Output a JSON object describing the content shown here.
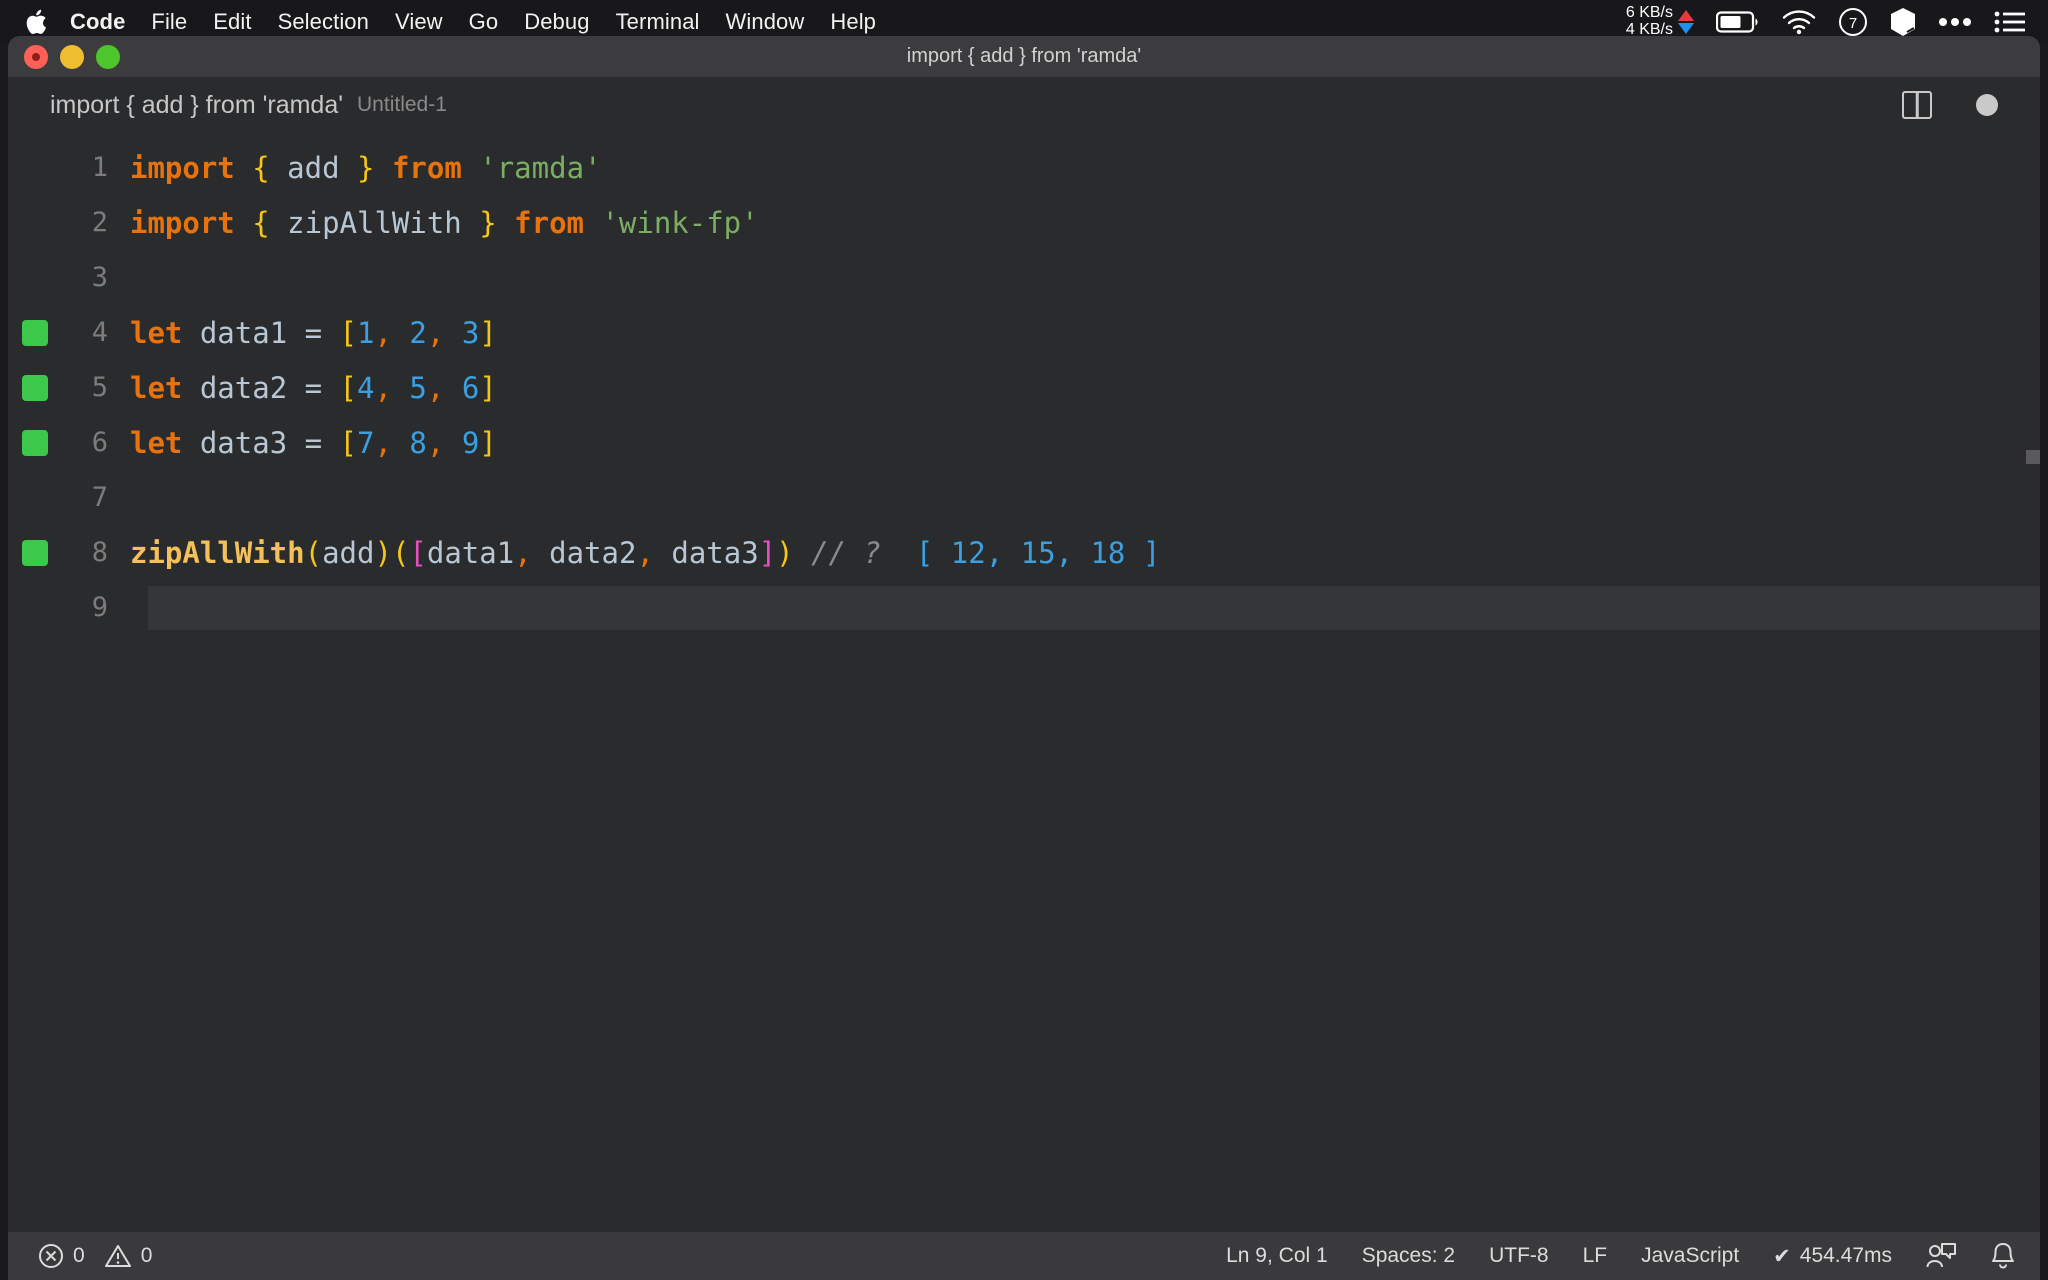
{
  "menubar": {
    "apple_icon": "apple-logo-icon",
    "items": [
      {
        "label": "Code",
        "bold": true
      },
      {
        "label": "File",
        "bold": false
      },
      {
        "label": "Edit",
        "bold": false
      },
      {
        "label": "Selection",
        "bold": false
      },
      {
        "label": "View",
        "bold": false
      },
      {
        "label": "Go",
        "bold": false
      },
      {
        "label": "Debug",
        "bold": false
      },
      {
        "label": "Terminal",
        "bold": false
      },
      {
        "label": "Window",
        "bold": false
      },
      {
        "label": "Help",
        "bold": false
      }
    ],
    "status": {
      "upload_speed": "6 KB/s",
      "download_speed": "4 KB/s",
      "upload_arrow_color": "#e8383a",
      "download_arrow_color": "#1e90ef",
      "icons": [
        "battery-icon",
        "wifi-icon",
        "clock-icon",
        "box-icon",
        "ellipsis-icon",
        "list-icon"
      ]
    }
  },
  "window": {
    "title": "import { add } from 'ramda'",
    "traffic_lights": [
      "close-button",
      "minimize-button",
      "maximize-button"
    ]
  },
  "breadcrumb": {
    "main": "import { add } from 'ramda'",
    "sub": "Untitled-1",
    "actions": [
      "split-editor-icon",
      "unsaved-indicator-dot"
    ]
  },
  "editor": {
    "lines": [
      {
        "number": "1",
        "marker": false,
        "tokens": [
          {
            "t": "import",
            "c": "kw"
          },
          {
            "t": " ",
            "c": "id"
          },
          {
            "t": "{",
            "c": "brace"
          },
          {
            "t": " add ",
            "c": "id"
          },
          {
            "t": "}",
            "c": "brace"
          },
          {
            "t": " ",
            "c": "id"
          },
          {
            "t": "from",
            "c": "kw"
          },
          {
            "t": " ",
            "c": "id"
          },
          {
            "t": "'ramda'",
            "c": "str"
          }
        ]
      },
      {
        "number": "2",
        "marker": false,
        "tokens": [
          {
            "t": "import",
            "c": "kw"
          },
          {
            "t": " ",
            "c": "id"
          },
          {
            "t": "{",
            "c": "brace"
          },
          {
            "t": " zipAllWith ",
            "c": "id"
          },
          {
            "t": "}",
            "c": "brace"
          },
          {
            "t": " ",
            "c": "id"
          },
          {
            "t": "from",
            "c": "kw"
          },
          {
            "t": " ",
            "c": "id"
          },
          {
            "t": "'wink-fp'",
            "c": "str"
          }
        ]
      },
      {
        "number": "3",
        "marker": false,
        "tokens": []
      },
      {
        "number": "4",
        "marker": true,
        "tokens": [
          {
            "t": "let",
            "c": "kw"
          },
          {
            "t": " data1 ",
            "c": "id"
          },
          {
            "t": "=",
            "c": "op"
          },
          {
            "t": " ",
            "c": "id"
          },
          {
            "t": "[",
            "c": "brace"
          },
          {
            "t": "1",
            "c": "num"
          },
          {
            "t": ",",
            "c": "punc"
          },
          {
            "t": " ",
            "c": "id"
          },
          {
            "t": "2",
            "c": "num"
          },
          {
            "t": ",",
            "c": "punc"
          },
          {
            "t": " ",
            "c": "id"
          },
          {
            "t": "3",
            "c": "num"
          },
          {
            "t": "]",
            "c": "brace"
          }
        ]
      },
      {
        "number": "5",
        "marker": true,
        "tokens": [
          {
            "t": "let",
            "c": "kw"
          },
          {
            "t": " data2 ",
            "c": "id"
          },
          {
            "t": "=",
            "c": "op"
          },
          {
            "t": " ",
            "c": "id"
          },
          {
            "t": "[",
            "c": "brace"
          },
          {
            "t": "4",
            "c": "num"
          },
          {
            "t": ",",
            "c": "punc"
          },
          {
            "t": " ",
            "c": "id"
          },
          {
            "t": "5",
            "c": "num"
          },
          {
            "t": ",",
            "c": "punc"
          },
          {
            "t": " ",
            "c": "id"
          },
          {
            "t": "6",
            "c": "num"
          },
          {
            "t": "]",
            "c": "brace"
          }
        ]
      },
      {
        "number": "6",
        "marker": true,
        "tokens": [
          {
            "t": "let",
            "c": "kw"
          },
          {
            "t": " data3 ",
            "c": "id"
          },
          {
            "t": "=",
            "c": "op"
          },
          {
            "t": " ",
            "c": "id"
          },
          {
            "t": "[",
            "c": "brace"
          },
          {
            "t": "7",
            "c": "num"
          },
          {
            "t": ",",
            "c": "punc"
          },
          {
            "t": " ",
            "c": "id"
          },
          {
            "t": "8",
            "c": "num"
          },
          {
            "t": ",",
            "c": "punc"
          },
          {
            "t": " ",
            "c": "id"
          },
          {
            "t": "9",
            "c": "num"
          },
          {
            "t": "]",
            "c": "brace"
          }
        ]
      },
      {
        "number": "7",
        "marker": false,
        "tokens": []
      },
      {
        "number": "8",
        "marker": true,
        "tokens": [
          {
            "t": "zipAllWith",
            "c": "fn"
          },
          {
            "t": "(",
            "c": "paren"
          },
          {
            "t": "add",
            "c": "id"
          },
          {
            "t": ")",
            "c": "paren"
          },
          {
            "t": "(",
            "c": "paren"
          },
          {
            "t": "[",
            "c": "magenta"
          },
          {
            "t": "data1",
            "c": "id"
          },
          {
            "t": ",",
            "c": "punc"
          },
          {
            "t": " ",
            "c": "id"
          },
          {
            "t": "data2",
            "c": "id"
          },
          {
            "t": ",",
            "c": "punc"
          },
          {
            "t": " ",
            "c": "id"
          },
          {
            "t": "data3",
            "c": "id"
          },
          {
            "t": "]",
            "c": "magenta"
          },
          {
            "t": ")",
            "c": "paren"
          },
          {
            "t": " ",
            "c": "id"
          },
          {
            "t": "// ?",
            "c": "comment"
          },
          {
            "t": "  ",
            "c": "id"
          },
          {
            "t": "[ 12, 15, 18 ]",
            "c": "qres"
          }
        ]
      },
      {
        "number": "9",
        "marker": false,
        "tokens": [],
        "cursor": true
      }
    ]
  },
  "statusbar": {
    "errors_icon": "error-circle-icon",
    "errors": "0",
    "warnings_icon": "warning-triangle-icon",
    "warnings": "0",
    "cursor_position": "Ln 9, Col 1",
    "indentation": "Spaces: 2",
    "encoding": "UTF-8",
    "eol": "LF",
    "language": "JavaScript",
    "quokka_check": "✔",
    "quokka_time": "454.47ms",
    "right_icons": [
      "feedback-icon",
      "bell-icon"
    ]
  }
}
